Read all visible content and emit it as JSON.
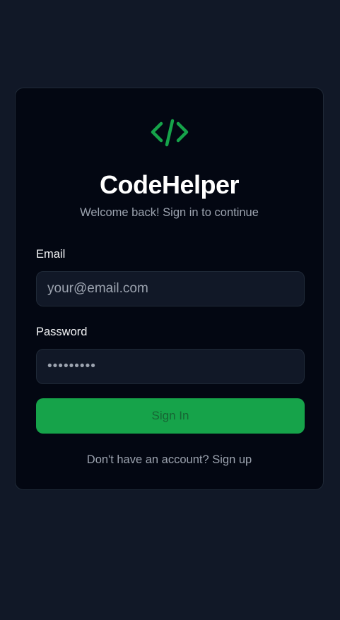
{
  "app": {
    "name": "CodeHelper",
    "subtitle": "Welcome back! Sign in to continue",
    "logo_icon": "code-brackets-icon",
    "accent_color": "#16a34a"
  },
  "form": {
    "email": {
      "label": "Email",
      "placeholder": "your@email.com",
      "value": ""
    },
    "password": {
      "label": "Password",
      "placeholder": "",
      "value": "•••••••••"
    },
    "submit_label": "Sign In"
  },
  "footer": {
    "prompt": "Don't have an account?",
    "link_label": "Sign up"
  }
}
